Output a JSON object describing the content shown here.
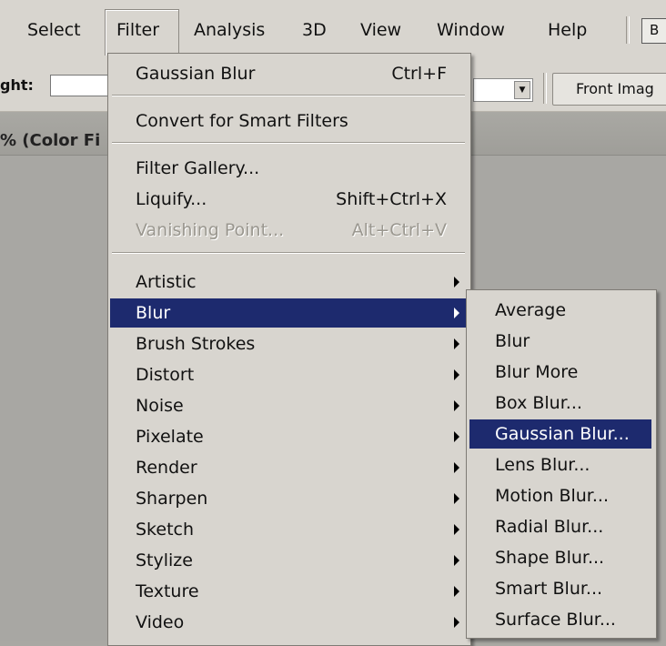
{
  "menubar": {
    "items": [
      "Select",
      "Filter",
      "Analysis",
      "3D",
      "View",
      "Window",
      "Help"
    ],
    "b_button": "B"
  },
  "options_bar": {
    "height_label": "ght:",
    "front_button": "Front Imag"
  },
  "document_tab": {
    "title": "% (Color Fi"
  },
  "filter_menu": {
    "last_filter": {
      "label": "Gaussian Blur",
      "shortcut": "Ctrl+F"
    },
    "convert_smart": {
      "label": "Convert for Smart Filters"
    },
    "filter_gallery": {
      "label": "Filter Gallery..."
    },
    "liquify": {
      "label": "Liquify...",
      "shortcut": "Shift+Ctrl+X"
    },
    "vanishing_point": {
      "label": "Vanishing Point...",
      "shortcut": "Alt+Ctrl+V"
    },
    "groups": [
      "Artistic",
      "Blur",
      "Brush Strokes",
      "Distort",
      "Noise",
      "Pixelate",
      "Render",
      "Sharpen",
      "Sketch",
      "Stylize",
      "Texture",
      "Video"
    ],
    "highlighted_group": "Blur"
  },
  "blur_submenu": {
    "items": [
      "Average",
      "Blur",
      "Blur More",
      "Box Blur...",
      "Gaussian Blur...",
      "Lens Blur...",
      "Motion Blur...",
      "Radial Blur...",
      "Shape Blur...",
      "Smart Blur...",
      "Surface Blur..."
    ],
    "highlighted": "Gaussian Blur..."
  },
  "colors": {
    "highlight": "#1d2a6e",
    "menu_bg": "#d8d5cf",
    "workspace": "#a8a7a3"
  }
}
